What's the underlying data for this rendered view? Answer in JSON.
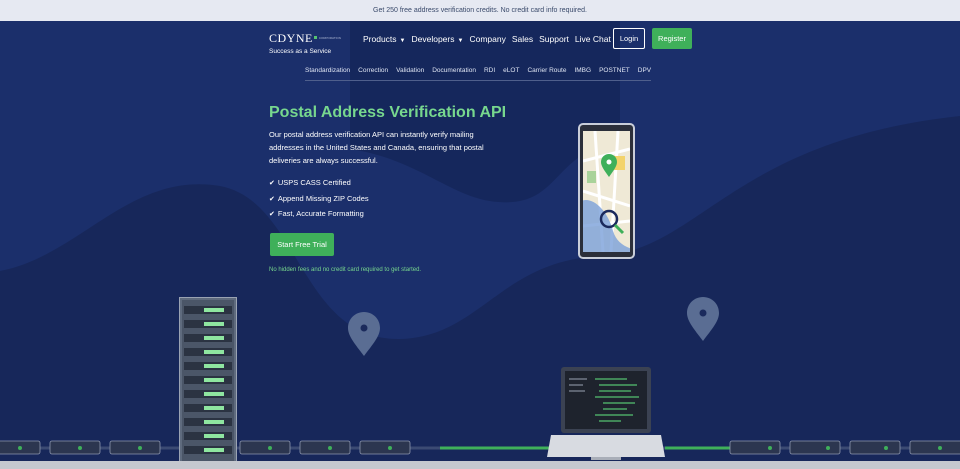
{
  "topbar": {
    "promo": "Get 250 free address verification credits. No credit card info required."
  },
  "header": {
    "brand": "CDYNE",
    "brand_suffix": "CORPORATION",
    "tagline": "Success as a Service",
    "nav": [
      {
        "label": "Products",
        "dropdown": true
      },
      {
        "label": "Developers",
        "dropdown": true
      },
      {
        "label": "Company",
        "dropdown": false
      },
      {
        "label": "Sales",
        "dropdown": false
      },
      {
        "label": "Support",
        "dropdown": false
      },
      {
        "label": "Live Chat",
        "dropdown": false
      }
    ],
    "login_label": "Login",
    "register_label": "Register"
  },
  "subnav": [
    "Standardization",
    "Correction",
    "Validation",
    "Documentation",
    "RDI",
    "eLOT",
    "Carrier Route",
    "IMBG",
    "POSTNET",
    "DPV"
  ],
  "hero": {
    "title": "Postal Address Verification API",
    "description": "Our postal address verification API can instantly verify mailing addresses in the United States and Canada, ensuring that postal deliveries are always successful.",
    "features": [
      "USPS CASS Certified",
      "Append Missing ZIP Codes",
      "Fast, Accurate Formatting"
    ],
    "cta_label": "Start Free Trial",
    "note": "No hidden fees and no credit card required to get started."
  },
  "colors": {
    "accent": "#3fb05a",
    "heading": "#77d78e",
    "background": "#17275a"
  },
  "icons": {
    "check": "check-icon",
    "caret": "chevron-down-icon",
    "map_pin": "map-pin-icon",
    "search": "search-icon"
  }
}
